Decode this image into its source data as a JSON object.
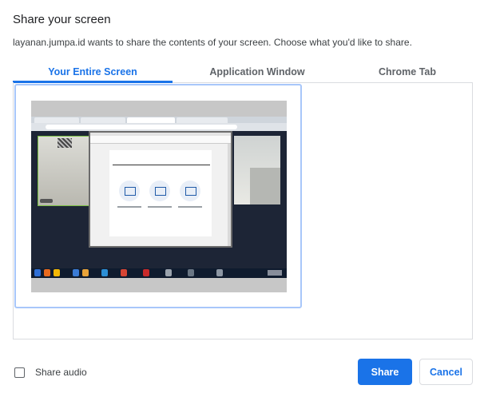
{
  "dialog": {
    "title": "Share your screen",
    "subtitle": "layanan.jumpa.id wants to share the contents of your screen. Choose what you'd like to share."
  },
  "tabs": [
    {
      "label": "Your Entire Screen",
      "active": true
    },
    {
      "label": "Application Window",
      "active": false
    },
    {
      "label": "Chrome Tab",
      "active": false
    }
  ],
  "screen_source": {
    "icon": "screen-thumbnail",
    "selected": true
  },
  "audio": {
    "label": "Share audio",
    "checked": false
  },
  "buttons": {
    "share": "Share",
    "cancel": "Cancel"
  },
  "colors": {
    "accent": "#1a73e8",
    "selection_border": "#a8c7fa"
  }
}
